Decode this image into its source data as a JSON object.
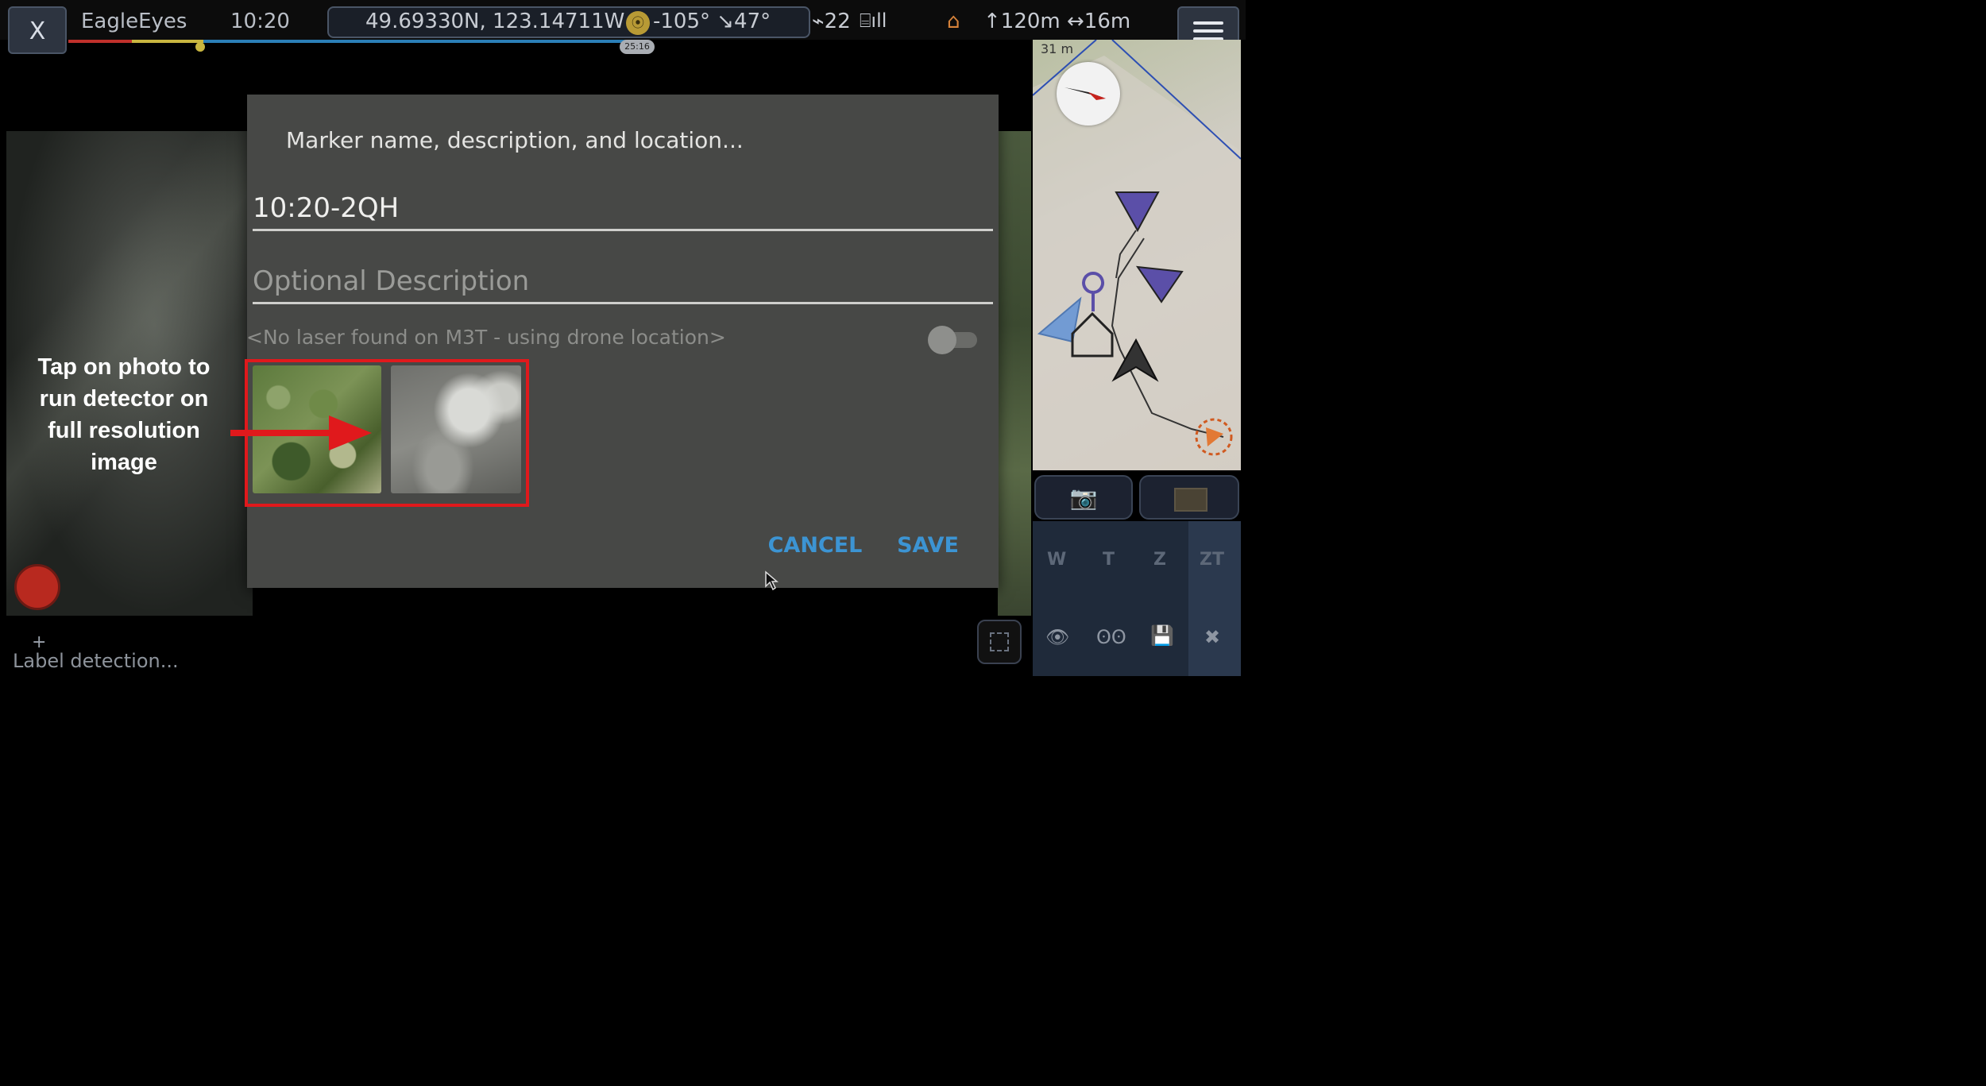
{
  "app": {
    "name": "EagleEyes",
    "close_label": "X",
    "clock": "10:20"
  },
  "telemetry": {
    "coordinates": "49.69330N, 123.14711W",
    "heading": "-105° ↘47°",
    "satellites": "22",
    "altitude_distance": "↑120m ↔16m"
  },
  "video": {
    "progress_fraction": 0.23,
    "timestamp_badge": "25:16"
  },
  "map": {
    "scale_label": "31 m"
  },
  "dialog": {
    "title": "Marker name, description, and location...",
    "name_value": "10:20-2QH",
    "description_placeholder": "Optional Description",
    "laser_note": "<No laser found on M3T - using drone location>",
    "laser_toggle_on": false,
    "cancel_label": "CANCEL",
    "save_label": "SAVE"
  },
  "annotation": {
    "text_lines": [
      "Tap on photo to",
      "run detector on",
      "full resolution",
      "image"
    ],
    "color": "#e0191c"
  },
  "zoom": {
    "labels": [
      "W",
      "T",
      "Z",
      "ZT"
    ]
  },
  "bottom": {
    "plus_label": "+",
    "label_detection": "Label detection..."
  },
  "colors": {
    "accent_blue": "#3c94d3",
    "record_red": "#b8291f",
    "annotation_red": "#e0191c"
  }
}
